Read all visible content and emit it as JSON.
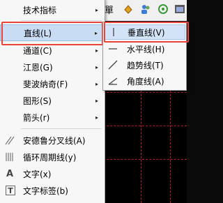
{
  "toolbar": {
    "partial_label": "單"
  },
  "main_menu": {
    "items": [
      {
        "label": "技术指标",
        "has_submenu": true,
        "icon": "none"
      },
      {
        "label": "直线(L)",
        "has_submenu": true,
        "icon": "none",
        "highlighted": true
      },
      {
        "label": "通道(C)",
        "has_submenu": true,
        "icon": "none"
      },
      {
        "label": "江恩(G)",
        "has_submenu": true,
        "icon": "none"
      },
      {
        "label": "斐波纳奇(F)",
        "has_submenu": true,
        "icon": "none"
      },
      {
        "label": "图形(S)",
        "has_submenu": true,
        "icon": "none"
      },
      {
        "label": "箭头(r)",
        "has_submenu": true,
        "icon": "none"
      },
      {
        "label": "安德鲁分叉线(A)",
        "has_submenu": false,
        "icon": "andrews-pitchfork-icon"
      },
      {
        "label": "循环周期线(y)",
        "has_submenu": false,
        "icon": "cycle-lines-icon"
      },
      {
        "label": "文字(x)",
        "has_submenu": false,
        "icon": "text-icon"
      },
      {
        "label": "文字标签(b)",
        "has_submenu": false,
        "icon": "text-label-icon"
      }
    ],
    "arrow_glyph": "▸",
    "text_icon_glyph": "A",
    "text_label_icon_glyph": "T"
  },
  "sub_menu": {
    "items": [
      {
        "label": "垂直线(V)",
        "icon": "vertical-line-icon",
        "highlighted": true
      },
      {
        "label": "水平线(H)",
        "icon": "horizontal-line-icon"
      },
      {
        "label": "趋势线(T)",
        "icon": "trendline-icon"
      },
      {
        "label": "角度线(A)",
        "icon": "angle-line-icon"
      }
    ]
  },
  "colors": {
    "highlight_box": "#e8443a",
    "menu_bg": "#f7f7f7",
    "chart_bg": "#000000",
    "grid_dash": "#b32020"
  }
}
